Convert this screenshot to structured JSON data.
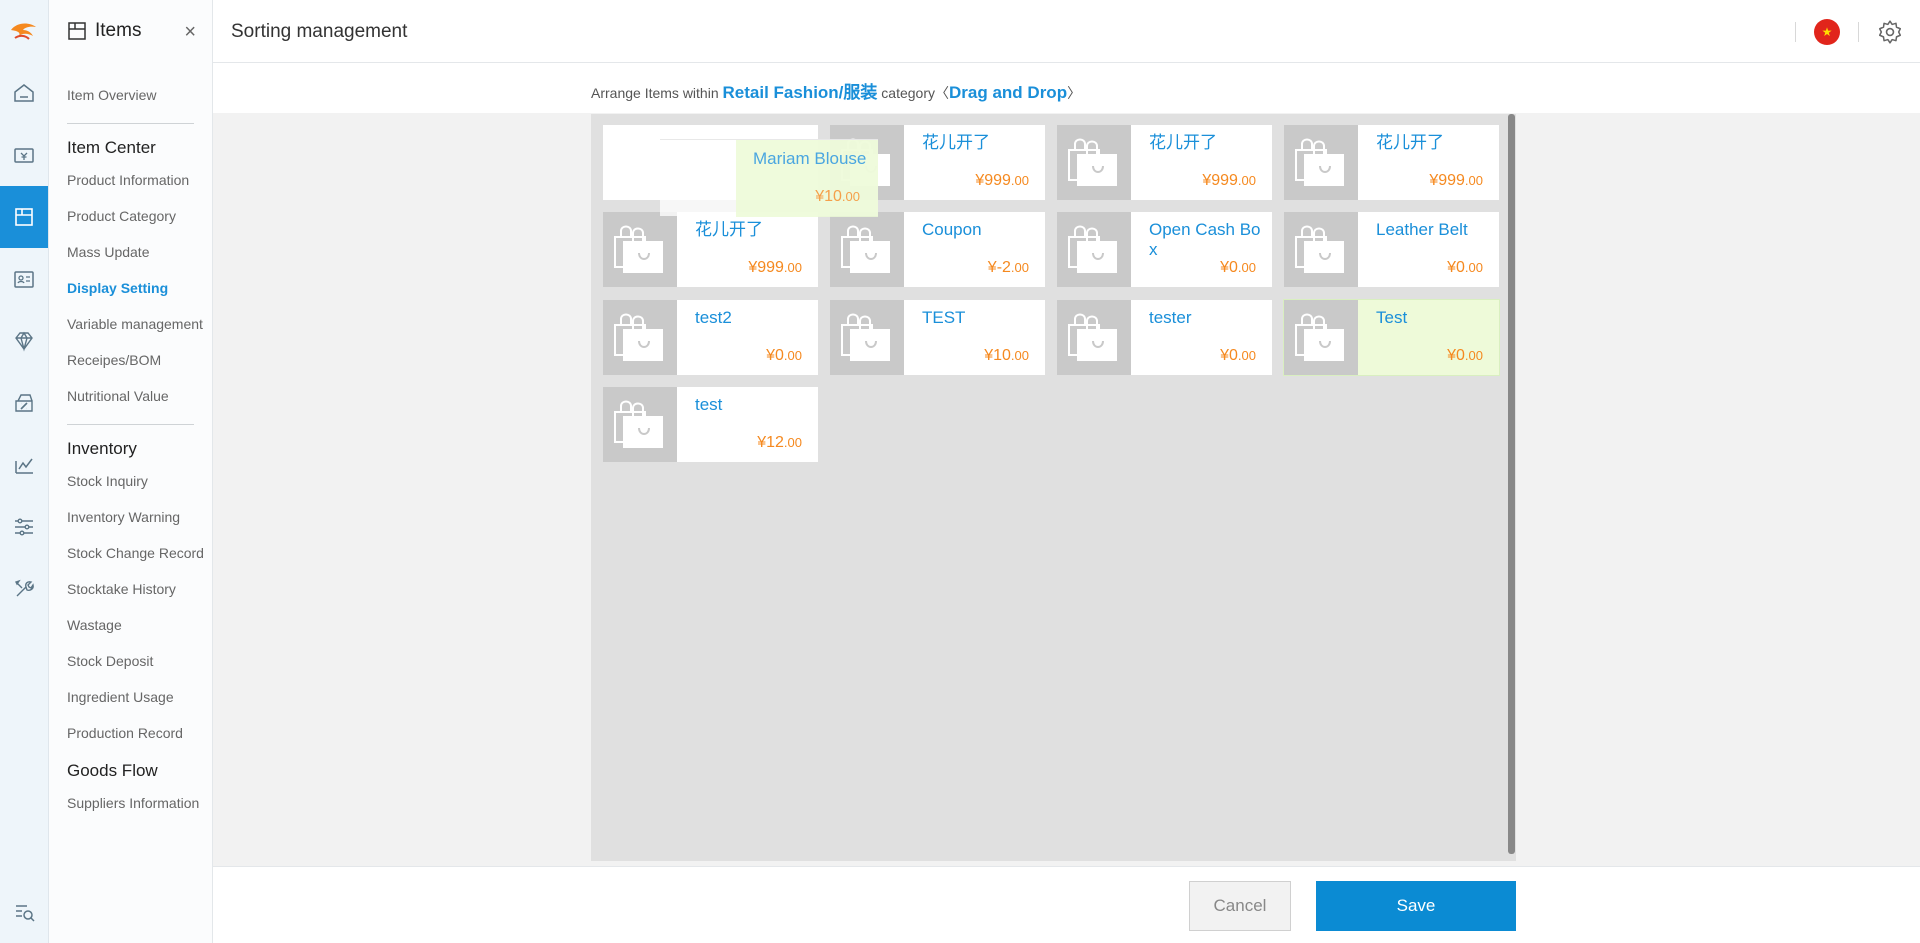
{
  "sidebar": {
    "title": "Items",
    "close": "×",
    "items": [
      {
        "type": "link",
        "label": "Item Overview"
      },
      {
        "type": "sep"
      },
      {
        "type": "section",
        "label": "Item Center"
      },
      {
        "type": "link",
        "label": "Product Information"
      },
      {
        "type": "link",
        "label": "Product Category"
      },
      {
        "type": "link",
        "label": "Mass Update"
      },
      {
        "type": "link",
        "label": "Display Setting",
        "active": true
      },
      {
        "type": "link",
        "label": "Variable management"
      },
      {
        "type": "link",
        "label": "Receipes/BOM"
      },
      {
        "type": "link",
        "label": "Nutritional Value"
      },
      {
        "type": "sep"
      },
      {
        "type": "section",
        "label": "Inventory"
      },
      {
        "type": "link",
        "label": "Stock Inquiry"
      },
      {
        "type": "link",
        "label": "Inventory Warning"
      },
      {
        "type": "link",
        "label": "Stock Change Record"
      },
      {
        "type": "link",
        "label": "Stocktake History"
      },
      {
        "type": "link",
        "label": "Wastage"
      },
      {
        "type": "link",
        "label": "Stock Deposit"
      },
      {
        "type": "link",
        "label": "Ingredient Usage"
      },
      {
        "type": "link",
        "label": "Production Record"
      },
      {
        "type": "section",
        "label": "Goods Flow"
      },
      {
        "type": "link",
        "label": "Suppliers Information"
      }
    ]
  },
  "header": {
    "title": "Sorting management",
    "language_icon": "china-flag-icon",
    "settings_icon": "gear-icon"
  },
  "info": {
    "prefix": "Arrange Items within ",
    "category": "Retail Fashion/服装",
    "middle": " category〈",
    "mode": "Drag and Drop",
    "suffix": "〉"
  },
  "items": [
    {
      "name": "",
      "price": "",
      "dec": "",
      "placeholder": true
    },
    {
      "name": "花儿开了",
      "price": "¥999",
      "dec": ".00"
    },
    {
      "name": "花儿开了",
      "price": "¥999",
      "dec": ".00"
    },
    {
      "name": "花儿开了",
      "price": "¥999",
      "dec": ".00"
    },
    {
      "name": "花儿开了",
      "price": "¥999",
      "dec": ".00"
    },
    {
      "name": "Coupon",
      "price": "¥-2",
      "dec": ".00"
    },
    {
      "name": "Open Cash Box",
      "price": "¥0",
      "dec": ".00"
    },
    {
      "name": "Leather Belt",
      "price": "¥0",
      "dec": ".00"
    },
    {
      "name": "test2",
      "price": "¥0",
      "dec": ".00"
    },
    {
      "name": "TEST",
      "price": "¥10",
      "dec": ".00"
    },
    {
      "name": "tester",
      "price": "¥0",
      "dec": ".00"
    },
    {
      "name": "Test",
      "price": "¥0",
      "dec": ".00",
      "highlight": true
    },
    {
      "name": "test",
      "price": "¥12",
      "dec": ".00"
    }
  ],
  "dragging": {
    "name": "Mariam Blouse",
    "price": "¥10",
    "dec": ".00"
  },
  "footer": {
    "cancel": "Cancel",
    "save": "Save"
  },
  "colors": {
    "accent": "#1a8fd9",
    "price": "#f5891f",
    "save": "#0b8bd3",
    "highlight": "#eefad9"
  }
}
